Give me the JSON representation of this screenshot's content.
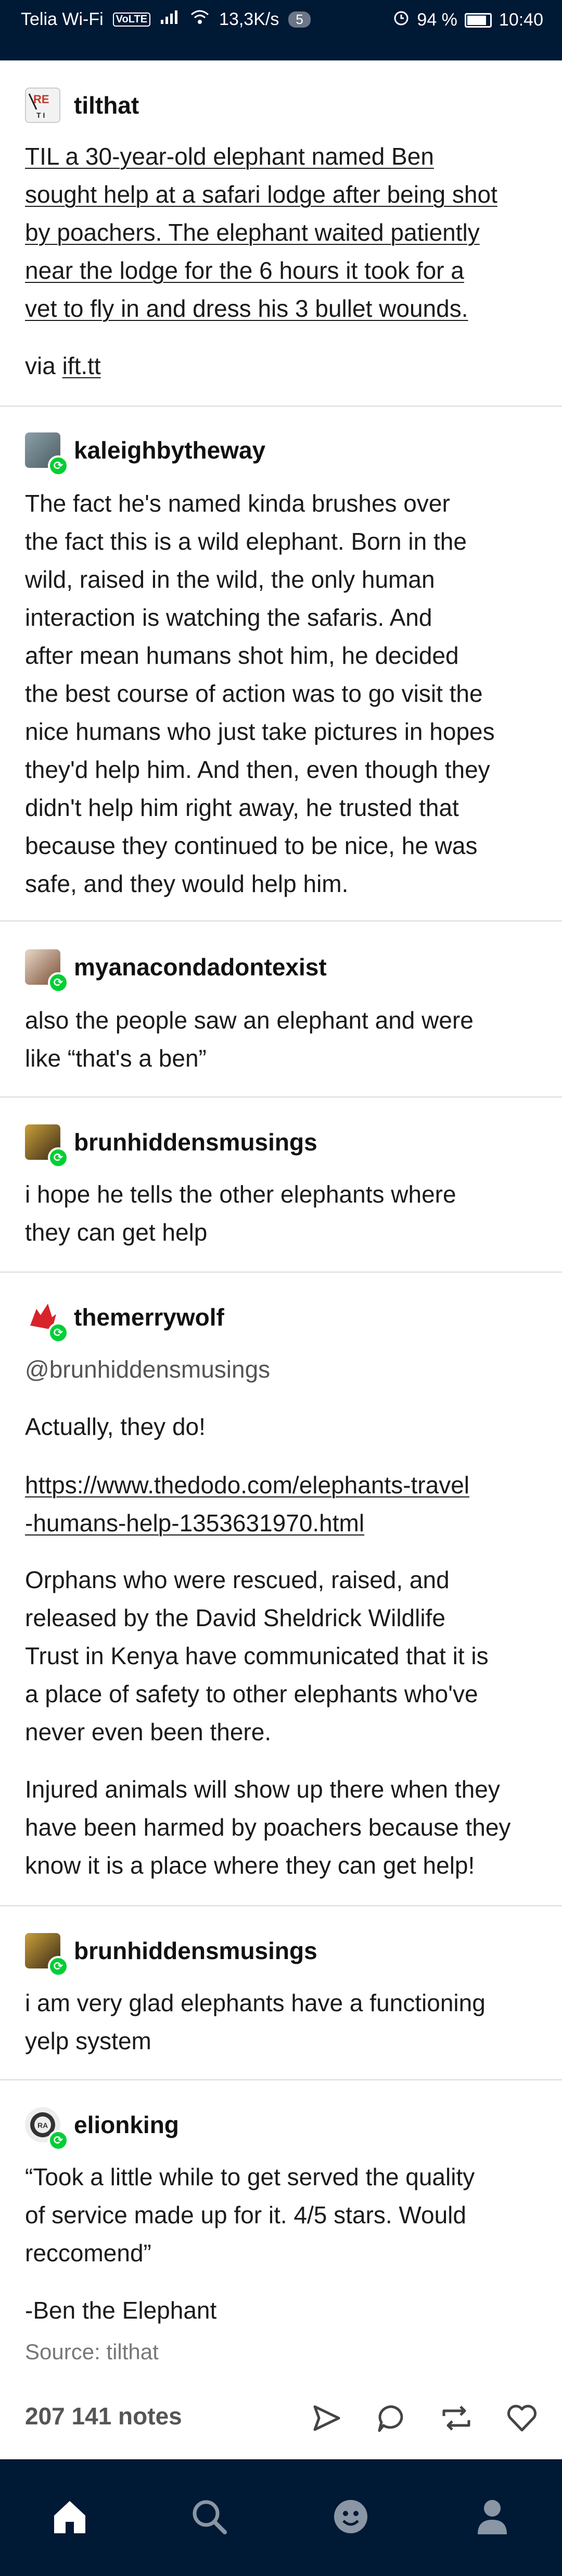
{
  "status_bar": {
    "carrier": "Telia Wi-Fi",
    "volte": "VoLTE",
    "speed": "13,3K/s",
    "notif_count": "5",
    "battery": "94 %",
    "time": "10:40"
  },
  "posts": [
    {
      "blog": "tilthat",
      "lines": [
        "TIL a 30-year-old elephant named Ben",
        "sought help at a safari lodge after being shot",
        "by poachers. The elephant waited patiently",
        "near the lodge for the 6 hours it took for a",
        "vet to fly in and dress his 3 bullet wounds."
      ],
      "via_prefix": "via ",
      "via_link": "ift.tt"
    },
    {
      "blog": "kaleighbytheway",
      "lines": [
        "The fact he's named kinda brushes over",
        "the fact this is a wild elephant. Born in the",
        "wild, raised in the wild, the only human",
        "interaction is watching the safaris. And",
        "after mean humans shot him, he decided",
        "the best course of action was to go visit the",
        "nice humans who just take pictures in hopes",
        "they'd help him. And then, even though they",
        "didn't help him right away, he trusted that",
        "because they continued to be nice, he was",
        "safe, and they would help him."
      ]
    },
    {
      "blog": "myanacondadontexist",
      "lines": [
        "also the people saw an elephant and were",
        "like “that's a ben”"
      ]
    },
    {
      "blog": "brunhiddensmusings",
      "lines": [
        "i hope he tells the other elephants where",
        "they can get help"
      ]
    },
    {
      "blog": "themerrywolf",
      "mention": "@brunhiddensmusings",
      "p1": "Actually, they do!",
      "link_lines": [
        "https://www.thedodo.com/elephants-travel",
        "-humans-help-1353631970.html"
      ],
      "p3_lines": [
        "Orphans who were rescued, raised, and",
        "released by the David Sheldrick Wildlife",
        "Trust in Kenya have communicated that it is",
        "a place of safety to other elephants who've",
        "never even been there."
      ],
      "p4_lines": [
        "Injured animals will show up there when they",
        "have been harmed by poachers because they",
        "know it is a place where they can get help!"
      ]
    },
    {
      "blog": "brunhiddensmusings",
      "lines": [
        "i am very glad elephants have a functioning",
        "yelp system"
      ]
    },
    {
      "blog": "elionking",
      "lines": [
        "“Took a little while to get served the quality",
        "of service made up for it. 4/5 stars. Would",
        "reccomend”"
      ],
      "signoff": "-Ben the Elephant"
    }
  ],
  "source": "Source: tilthat",
  "notes": "207 141 notes",
  "icons": {
    "share": "send-icon",
    "reply": "comment-icon",
    "reblog": "reblog-icon",
    "like": "heart-icon"
  },
  "tabs": [
    "home-icon",
    "search-icon",
    "activity-face-icon",
    "account-icon"
  ]
}
